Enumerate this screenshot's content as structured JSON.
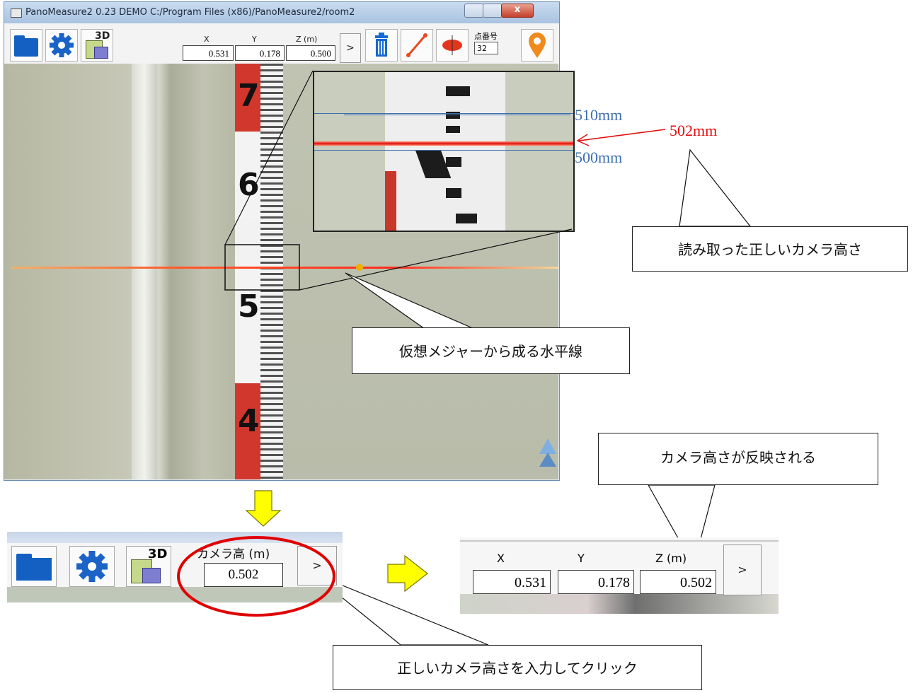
{
  "window": {
    "title": "PanoMeasure2 0.23 DEMO  C:/Program Files (x86)/PanoMeasure2/room2",
    "close_glyph": "x"
  },
  "toolbar": {
    "icons": [
      "folder-icon",
      "gear-icon",
      "3d-view-icon",
      "trash-icon",
      "measure-line-icon",
      "plane-icon",
      "location-pin-icon"
    ],
    "label_3d": "3D",
    "coords": {
      "x_label": "X",
      "y_label": "Y",
      "z_label": "Z (m)",
      "x": "0.531",
      "y": "0.178",
      "z": "0.500"
    },
    "arrow": ">",
    "point_label": "点番号",
    "point_value": "32"
  },
  "photo": {
    "ruler_numbers": [
      "7",
      "6",
      "5",
      "4"
    ]
  },
  "annotations": {
    "mark_510": "510mm",
    "mark_500": "500mm",
    "mark_502": "502mm",
    "callout_correct_height": "読み取った正しいカメラ高さ",
    "callout_horizontal_line": "仮想メジャーから成る水平線",
    "callout_reflected": "カメラ高さが反映される",
    "callout_input_click": "正しいカメラ高さを入力してクリック"
  },
  "lower_left": {
    "label_3d": "3D",
    "camera_height_label": "カメラ高 (m)",
    "camera_height_value": "0.502",
    "arrow": ">"
  },
  "lower_right": {
    "x_label": "X",
    "y_label": "Y",
    "z_label": "Z (m)",
    "x": "0.531",
    "y": "0.178",
    "z": "0.502",
    "arrow": ">"
  },
  "colors": {
    "annotation_blue": "#3d6fb0",
    "annotation_red": "#e10d0d",
    "arrow_yellow": "#ffff00",
    "highlight_ellipse": "#e00000"
  }
}
